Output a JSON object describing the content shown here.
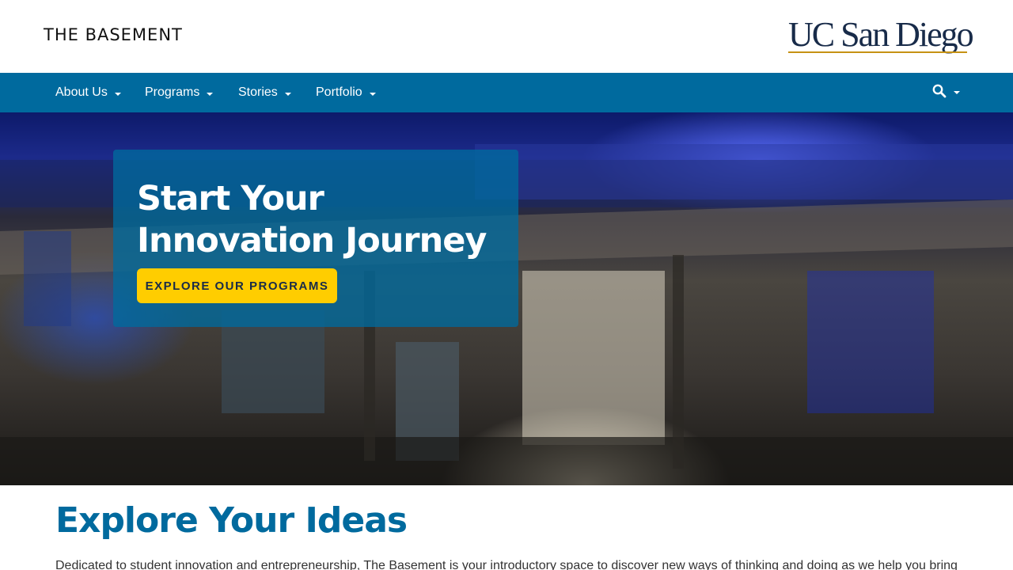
{
  "header": {
    "site_title": "THE BASEMENT",
    "logo_text": "UC San Diego"
  },
  "nav": {
    "items": [
      {
        "label": "About Us"
      },
      {
        "label": "Programs"
      },
      {
        "label": "Stories"
      },
      {
        "label": "Portfolio"
      }
    ],
    "search_icon": "search-icon"
  },
  "hero": {
    "title": "Start Your Innovation Journey Here",
    "cta_label": "EXPLORE OUR PROGRAMS"
  },
  "content": {
    "heading": "Explore Your Ideas",
    "text": "Dedicated to student innovation and entrepreneurship, The Basement is your introductory space to discover new ways of thinking and doing as we help you bring"
  },
  "colors": {
    "nav_blue": "#006a9e",
    "cta_yellow": "#ffcd00",
    "navy": "#182b49",
    "gold": "#c69214"
  }
}
